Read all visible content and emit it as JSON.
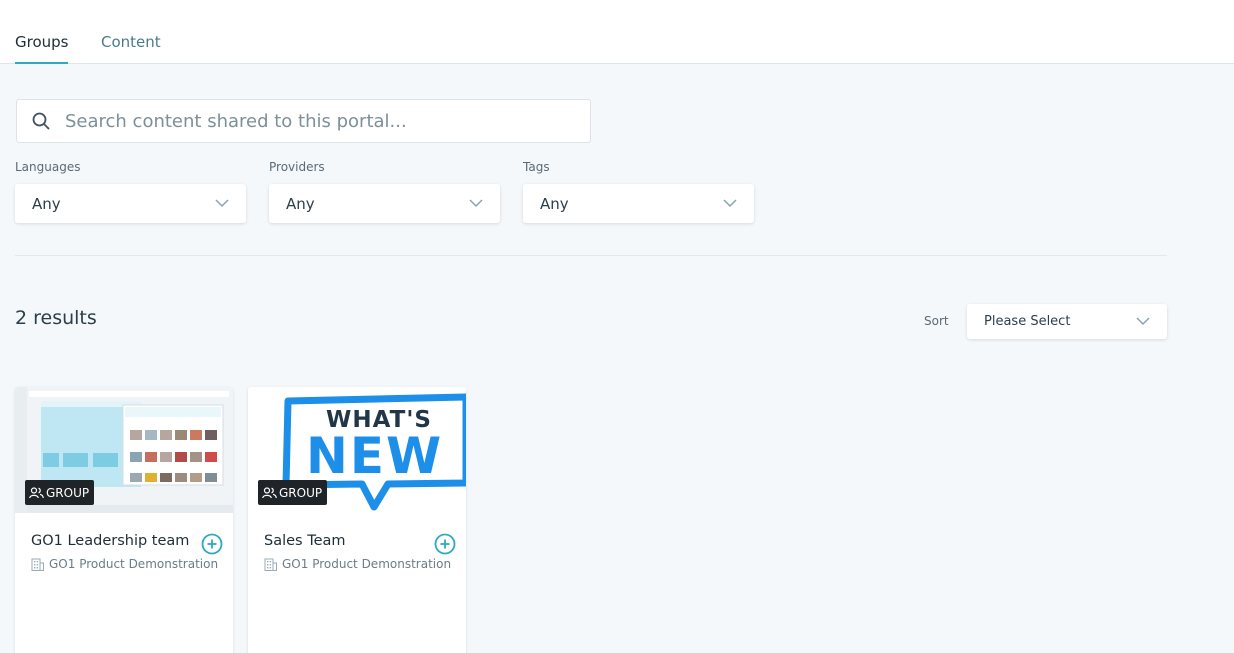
{
  "tabs": [
    {
      "label": "Groups",
      "active": true
    },
    {
      "label": "Content",
      "active": false
    }
  ],
  "search": {
    "placeholder": "Search content shared to this portal...",
    "icon": "search-icon"
  },
  "filters": [
    {
      "label": "Languages",
      "value": "Any"
    },
    {
      "label": "Providers",
      "value": "Any"
    },
    {
      "label": "Tags",
      "value": "Any"
    }
  ],
  "results": {
    "count_text": "2 results"
  },
  "sort": {
    "label": "Sort",
    "value": "Please Select"
  },
  "cards": [
    {
      "badge": "GROUP",
      "title": "GO1 Leadership team",
      "subtitle": "GO1 Product Demonstration"
    },
    {
      "badge": "GROUP",
      "title": "Sales Team",
      "subtitle": "GO1 Product Demonstration",
      "thumb_text_1": "WHAT'S",
      "thumb_text_2": "NEW"
    }
  ],
  "colors": {
    "accent": "#2eaac0",
    "whatsnew_blue": "#1d8fe8",
    "whatsnew_dark": "#22364a"
  }
}
